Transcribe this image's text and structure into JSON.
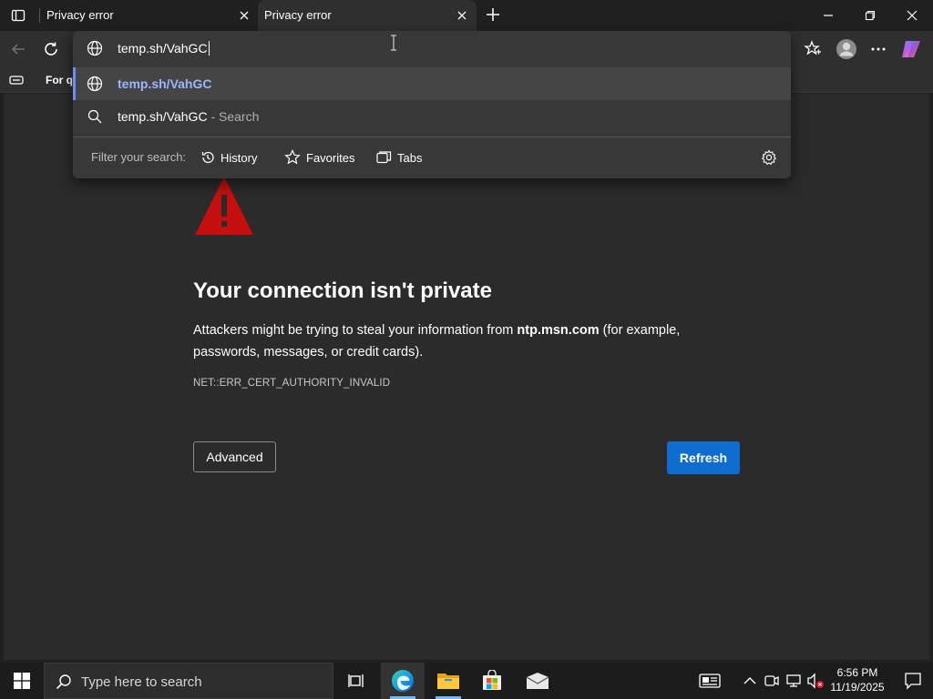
{
  "tabs": [
    {
      "title": "Privacy error",
      "active": false
    },
    {
      "title": "Privacy error",
      "active": true
    }
  ],
  "toolbar": {
    "back_icon": "back-arrow-icon",
    "refresh_icon": "refresh-icon",
    "favorites_icon": "favorites-star-icon",
    "profile_icon": "profile-avatar-icon",
    "more_icon": "more-ellipsis-icon",
    "copilot_icon": "copilot-icon"
  },
  "favorites_bar": {
    "text": "For q"
  },
  "omnibox": {
    "input_value": "temp.sh/VahGC",
    "suggestions": [
      {
        "icon": "globe-icon",
        "text": "temp.sh/VahGC",
        "sub": ""
      },
      {
        "icon": "search-icon",
        "text": "temp.sh/VahGC",
        "sub": " - Search"
      }
    ],
    "filter_label": "Filter your search:",
    "filters": [
      {
        "icon": "history-icon",
        "label": "History"
      },
      {
        "icon": "star-icon",
        "label": "Favorites"
      },
      {
        "icon": "tabs-icon",
        "label": "Tabs"
      }
    ]
  },
  "error_page": {
    "title": "Your connection isn't private",
    "desc_before": "Attackers might be trying to steal your information from ",
    "desc_host": "ntp.msn.com",
    "desc_after": " (for example, passwords, messages, or credit cards).",
    "error_code": "NET::ERR_CERT_AUTHORITY_INVALID",
    "advanced_label": "Advanced",
    "refresh_label": "Refresh",
    "accent_color": "#0f6cd0",
    "warning_color": "#c50f0f"
  },
  "taskbar": {
    "search_placeholder": "Type here to search",
    "time": "6:56 PM",
    "date": "11/19/2025"
  }
}
